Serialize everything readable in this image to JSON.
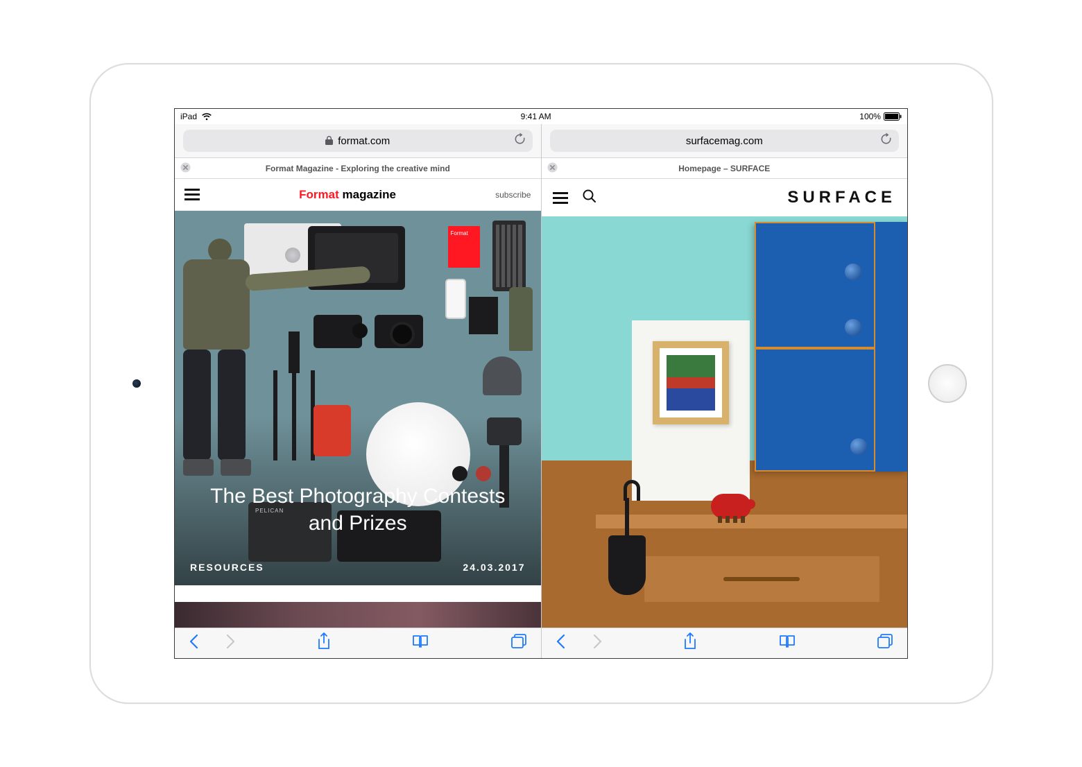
{
  "status": {
    "device": "iPad",
    "time": "9:41 AM",
    "battery_pct": "100%"
  },
  "left": {
    "url_host": "format.com",
    "tab_title": "Format Magazine - Exploring the creative mind",
    "site": {
      "logo_红": "Format",
      "logo_rest": "magazine",
      "subscribe": "subscribe",
      "hero_title_line1": "The Best Photography Contests",
      "hero_title_line2": "and Prizes",
      "category": "RESOURCES",
      "date": "24.03.2017"
    }
  },
  "right": {
    "url_host": "surfacemag.com",
    "tab_title": "Homepage – SURFACE",
    "site": {
      "logo": "SURFACE"
    }
  }
}
